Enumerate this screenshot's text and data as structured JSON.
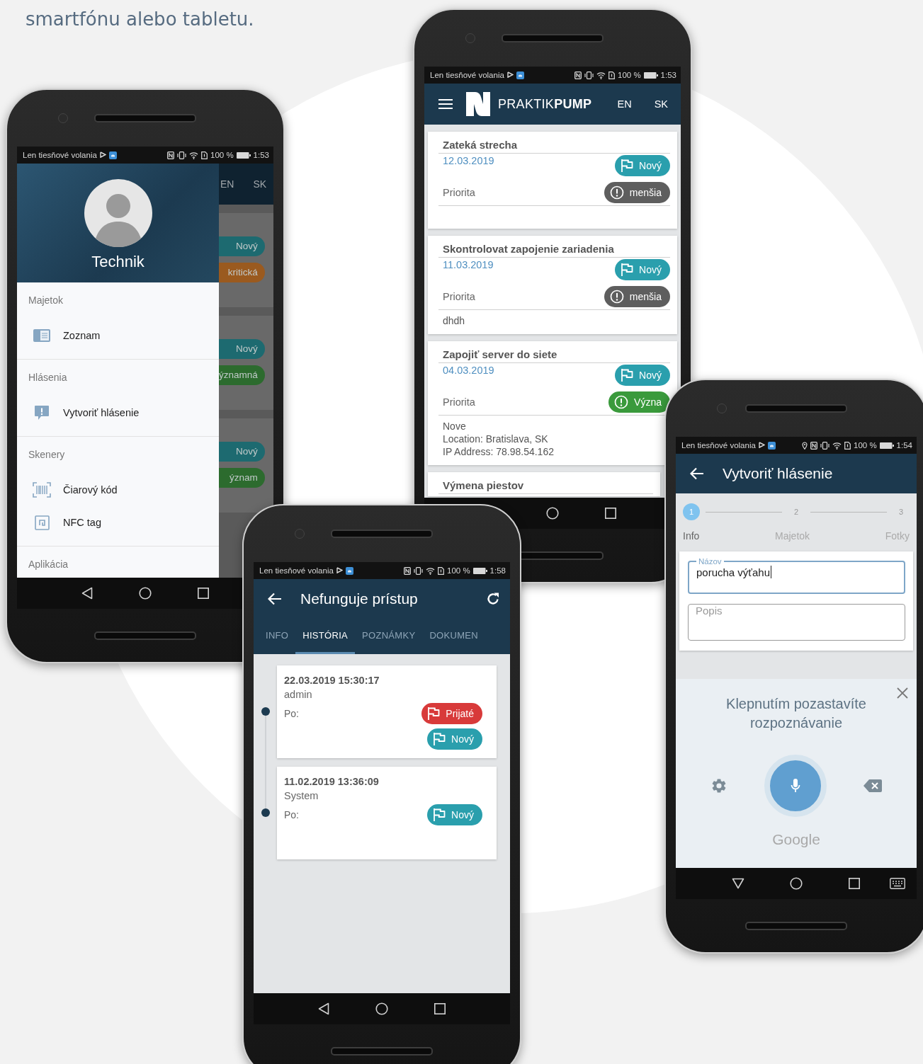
{
  "heading": "smartfónu alebo tabletu.",
  "phones": [
    {
      "kind": "drawer",
      "status": {
        "carrier": "Len tiesňové volania",
        "location": false,
        "battery": "100 %",
        "time": "1:53"
      },
      "drawer": {
        "user": "Technik",
        "sections": [
          {
            "title": "Majetok",
            "items": [
              {
                "label": "Zoznam",
                "kind": "list"
              }
            ]
          },
          {
            "title": "Hlásenia",
            "items": [
              {
                "label": "Vytvoriť hlásenie",
                "kind": "report"
              }
            ]
          },
          {
            "title": "Skenery",
            "items": [
              {
                "label": "Čiarový kód",
                "kind": "barcode"
              },
              {
                "label": "NFC tag",
                "kind": "nfc"
              }
            ]
          },
          {
            "title": "Aplikácia"
          }
        ]
      },
      "background": {
        "languages": [
          "EN",
          "SK"
        ],
        "cards": [
          {
            "chips": [
              {
                "label": "Nový",
                "color": "#1d6a70"
              },
              {
                "label": "kritická",
                "color": "#9a5a1f"
              }
            ]
          },
          {
            "chips": [
              {
                "label": "Nový",
                "color": "#1d6a70"
              },
              {
                "label": "ýznamná",
                "color": "#2c6b2e"
              }
            ]
          },
          {
            "chips": [
              {
                "label": "Nový",
                "color": "#1d6a70"
              },
              {
                "label": "ýznam",
                "color": "#2c6b2e"
              }
            ]
          }
        ]
      },
      "nav": [
        {
          "kind": "back"
        },
        {
          "kind": "home"
        },
        {
          "kind": "recents"
        }
      ]
    },
    {
      "kind": "list",
      "status": {
        "carrier": "Len tiesňové volania",
        "location": false,
        "battery": "100 %",
        "time": "1:53"
      },
      "appbar": {
        "brand": "PRAKTIK**PUMP**",
        "languages": [
          "EN",
          "SK"
        ]
      },
      "cards": [
        {
          "title": "Zateká strecha",
          "date": "12.03.2019",
          "status": {
            "label": "Nový",
            "color": "#2a9fad"
          },
          "priority_label": "Priorita",
          "priority": {
            "label": "menšia",
            "color": "#5e5e5e"
          }
        },
        {
          "title": "Skontrolovat zapojenie zariadenia",
          "date": "11.03.2019",
          "status": {
            "label": "Nový",
            "color": "#2a9fad"
          },
          "priority_label": "Priorita",
          "priority": {
            "label": "menšia",
            "color": "#5e5e5e"
          },
          "note": "dhdh"
        },
        {
          "title": "Zapojiť server do siete",
          "date": "04.03.2019",
          "status": {
            "label": "Nový",
            "color": "#2a9fad"
          },
          "priority_label": "Priorita",
          "priority": {
            "label": "Význa",
            "color": "#3a9a3c"
          },
          "note": "Nove\nLocation: Bratislava, SK\nIP Address: 78.98.54.162"
        },
        {
          "title": "Výmena piestov"
        }
      ],
      "nav": [
        {
          "kind": "home"
        },
        {
          "kind": "recents"
        }
      ]
    },
    {
      "kind": "history",
      "status": {
        "carrier": "Len tiesňové volania",
        "location": false,
        "battery": "100 %",
        "time": "1:58"
      },
      "appbar": {
        "title": "Nefunguje prístup"
      },
      "tabs": [
        {
          "label": "INFO",
          "selected": false
        },
        {
          "label": "HISTÓRIA",
          "selected": true
        },
        {
          "label": "POZNÁMKY",
          "selected": false
        },
        {
          "label": "DOKUMEN",
          "selected": false
        }
      ],
      "entries": [
        {
          "time": "22.03.2019 15:30:17",
          "user": "admin",
          "label": "Po:",
          "chips": [
            {
              "label": "Prijaté",
              "color": "#d83a3a"
            },
            {
              "label": "Nový",
              "color": "#2a9fad"
            }
          ]
        },
        {
          "time": "11.02.2019 13:36:09",
          "user": "System",
          "label": "Po:",
          "chips": [
            {
              "label": "Nový",
              "color": "#2a9fad"
            }
          ]
        }
      ],
      "nav": [
        {
          "kind": "back"
        },
        {
          "kind": "home"
        },
        {
          "kind": "recents"
        }
      ]
    },
    {
      "kind": "form",
      "status": {
        "carrier": "Len tiesňové volania",
        "location": true,
        "battery": "100 %",
        "time": "1:54"
      },
      "appbar": {
        "title": "Vytvoriť hlásenie"
      },
      "steps": [
        {
          "number": "1",
          "label": "Info",
          "selected": true
        },
        {
          "number": "2",
          "label": "Majetok",
          "selected": false
        },
        {
          "number": "3",
          "label": "Fotky",
          "selected": false
        }
      ],
      "fields": [
        {
          "label": "Názov",
          "value": "porucha výťahu",
          "focused": true
        },
        {
          "placeholder": "Popis",
          "focused": false
        }
      ],
      "voice": {
        "prompt": "Klepnutím pozastavíte rozpoznávanie",
        "brand": "Google"
      },
      "nav": [
        {
          "kind": "hide"
        },
        {
          "kind": "home"
        },
        {
          "kind": "recents"
        },
        {
          "kind": "keyboard"
        }
      ]
    }
  ]
}
